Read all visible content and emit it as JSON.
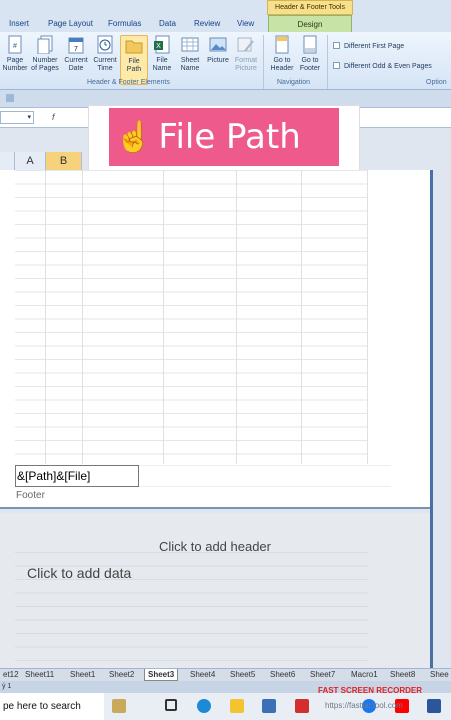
{
  "ribbon_tabs": {
    "insert": "Insert",
    "page_layout": "Page Layout",
    "formulas": "Formulas",
    "data": "Data",
    "review": "Review",
    "view": "View",
    "context_title": "Header & Footer Tools",
    "design": "Design"
  },
  "ribbon": {
    "buttons": [
      {
        "top": "Page",
        "bottom": "Number"
      },
      {
        "top": "Number",
        "bottom": "of Pages"
      },
      {
        "top": "Current",
        "bottom": "Date"
      },
      {
        "top": "Current",
        "bottom": "Time"
      },
      {
        "top": "File",
        "bottom": "Path"
      },
      {
        "top": "File",
        "bottom": "Name"
      },
      {
        "top": "Sheet",
        "bottom": "Name"
      },
      {
        "top": "Picture",
        "bottom": ""
      },
      {
        "top": "Format",
        "bottom": "Picture"
      },
      {
        "top": "Go to",
        "bottom": "Header"
      },
      {
        "top": "Go to",
        "bottom": "Footer"
      }
    ],
    "group_elements": "Header & Footer Elements",
    "group_navigation": "Navigation",
    "group_options": "Option",
    "opt_first_page": "Different First Page",
    "opt_odd_even": "Different Odd & Even Pages"
  },
  "formula_bar": {
    "fx": "f"
  },
  "banner": {
    "emoji": "☝",
    "text": "File Path"
  },
  "columns": [
    "A",
    "B"
  ],
  "footer": {
    "value": "&[Path]&[File]",
    "label": "Footer"
  },
  "page2": {
    "header_placeholder": "Click to add header",
    "data_placeholder": "Click to add data"
  },
  "sheet_tabs": [
    "et12",
    "Sheet11",
    "Sheet1",
    "Sheet2",
    "Sheet3",
    "Sheet4",
    "Sheet5",
    "Sheet6",
    "Sheet7",
    "Macro1",
    "Sheet8",
    "Shee"
  ],
  "active_sheet": "Sheet3",
  "status": {
    "page": "ý 1"
  },
  "taskbar": {
    "search": "pe here to search",
    "recorder": "FAST SCREEN RECORDER",
    "watermark": "https://fastfactool.com"
  },
  "colors": {
    "banner_bg": "#ee5a8c",
    "ribbon_tab_design": "#c7e3a6",
    "context_tab": "#f8e08a"
  }
}
